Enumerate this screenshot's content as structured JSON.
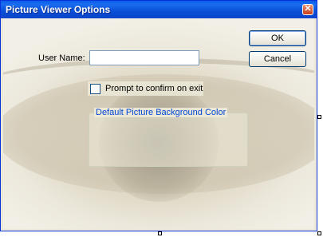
{
  "window": {
    "title": "Picture Viewer Options",
    "close_glyph": "✕"
  },
  "form": {
    "user_name_label": "User Name:",
    "user_name_value": "",
    "prompt_checkbox_label": "Prompt to confirm on exit",
    "prompt_checked": false,
    "group_title": "Default Picture Background Color"
  },
  "buttons": {
    "ok_label": "OK",
    "cancel_label": "Cancel"
  },
  "colors": {
    "title_bar": "#0a4fd6",
    "dialog_face": "#ece9d8",
    "group_title_text": "#0046d5"
  },
  "icons": {
    "close": "close-icon",
    "background": "eye-photo-background"
  }
}
